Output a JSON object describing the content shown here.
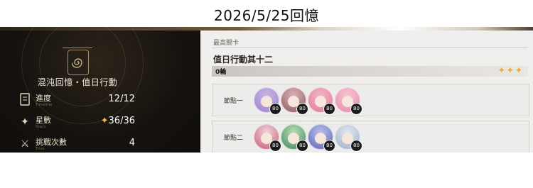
{
  "page_title": "2026/5/25回憶",
  "left_panel": {
    "mode_title": "混沌回憶・值日行動",
    "emblem_icon": "spiral-icon",
    "stats": [
      {
        "label": "進度",
        "sub": "Timeline",
        "value": "12/12",
        "icon": "scroll-icon"
      },
      {
        "label": "星數",
        "sub": "Stars",
        "value": "36/36",
        "icon": "star-icon"
      },
      {
        "label": "挑戰次數",
        "sub": "Tries",
        "value": "4",
        "icon": "crossed-swords-icon"
      }
    ]
  },
  "right_panel": {
    "section_label": "最高關卡",
    "level_name": "值日行動其十二",
    "rounds": "0輪",
    "stars": "✦✦✦",
    "nodes": [
      {
        "label": "節點一",
        "avatars": [
          {
            "level": "80",
            "color": "#c9b5e6",
            "hair": "#9c83c9"
          },
          {
            "level": "80",
            "color": "#d9b3b8",
            "hair": "#8f5a63"
          },
          {
            "level": "80",
            "color": "#f2b3c4",
            "hair": "#e07d98"
          },
          {
            "level": "80",
            "color": "#f6c3d3",
            "hair": "#e98aaa"
          }
        ]
      },
      {
        "label": "節點二",
        "avatars": [
          {
            "level": "80",
            "color": "#f0d2dc",
            "hair": "#c65c74"
          },
          {
            "level": "80",
            "color": "#b7dcb6",
            "hair": "#3f8a59"
          },
          {
            "level": "80",
            "color": "#b8bfe8",
            "hair": "#5a66b8"
          },
          {
            "level": "80",
            "color": "#dfe6ef",
            "hair": "#9fb0c9"
          }
        ]
      }
    ]
  },
  "colors": {
    "star_gold": "#f3a42b",
    "dark_bg": "#161310",
    "light_panel": "#f0efed"
  }
}
